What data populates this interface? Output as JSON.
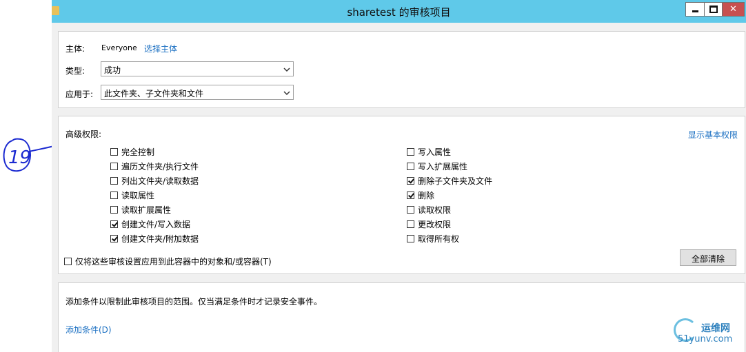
{
  "window": {
    "title": "sharetest 的审核项目",
    "controls": {
      "minimize_icon": "minimize-icon",
      "maximize_icon": "maximize-icon",
      "close_glyph": "✕"
    }
  },
  "principal": {
    "label": "主体:",
    "value": "Everyone",
    "select_link": "选择主体"
  },
  "type_field": {
    "label": "类型:",
    "value": "成功"
  },
  "applies_to": {
    "label": "应用于:",
    "value": "此文件夹、子文件夹和文件"
  },
  "advanced": {
    "heading": "高级权限:",
    "show_basic_link": "显示基本权限",
    "left": [
      {
        "label": "完全控制",
        "checked": false
      },
      {
        "label": "遍历文件夹/执行文件",
        "checked": false
      },
      {
        "label": "列出文件夹/读取数据",
        "checked": false
      },
      {
        "label": "读取属性",
        "checked": false
      },
      {
        "label": "读取扩展属性",
        "checked": false
      },
      {
        "label": "创建文件/写入数据",
        "checked": true
      },
      {
        "label": "创建文件夹/附加数据",
        "checked": true
      }
    ],
    "right": [
      {
        "label": "写入属性",
        "checked": false
      },
      {
        "label": "写入扩展属性",
        "checked": false
      },
      {
        "label": "删除子文件夹及文件",
        "checked": true
      },
      {
        "label": "删除",
        "checked": true
      },
      {
        "label": "读取权限",
        "checked": false
      },
      {
        "label": "更改权限",
        "checked": false
      },
      {
        "label": "取得所有权",
        "checked": false
      }
    ],
    "apply_only_label": "仅将这些审核设置应用到此容器中的对象和/或容器(T)",
    "apply_only_checked": false,
    "clear_all_button": "全部清除"
  },
  "condition": {
    "description": "添加条件以限制此审核项目的范围。仅当满足条件时才记录安全事件。",
    "add_link": "添加条件(D)"
  },
  "annotation": {
    "handwritten_number": "19"
  },
  "watermark": {
    "cn": "运维网",
    "en": "51yunv.com"
  },
  "colors": {
    "titlebar": "#5fc9e9",
    "link": "#1a6fc2",
    "close_button": "#c75050"
  }
}
